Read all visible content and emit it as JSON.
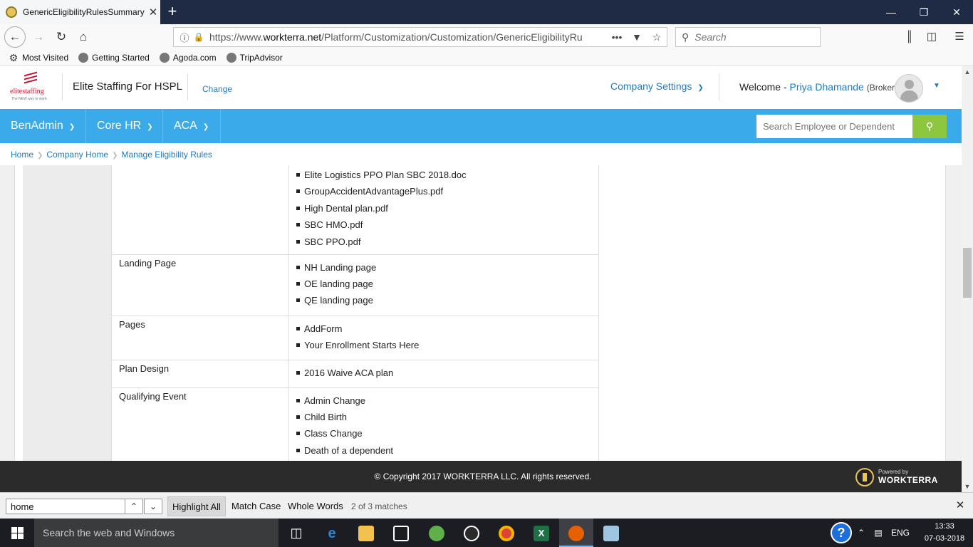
{
  "browser": {
    "tab_title": "GenericEligibilityRulesSummary",
    "tab_close": "✕",
    "new_tab": "+",
    "url_prefix": "https://www.",
    "url_domain": "workterra.net",
    "url_path": "/Platform/Customization/Customization/GenericEligibilityRu",
    "search_placeholder": "Search",
    "bookmarks": [
      {
        "label": "Most Visited",
        "icon": "gear-icon"
      },
      {
        "label": "Getting Started",
        "icon": "firefox-icon"
      },
      {
        "label": "Agoda.com",
        "icon": "globe-icon"
      },
      {
        "label": "TripAdvisor",
        "icon": "globe-icon"
      }
    ]
  },
  "header": {
    "logo_text": "elitestaffing",
    "logo_tagline": "The NEW way to work.",
    "company_name": "Elite Staffing For HSPL",
    "change_label": "Change",
    "company_settings_label": "Company Settings",
    "welcome_label": "Welcome -",
    "user_name": "Priya Dhamande",
    "user_role": "(Broker)"
  },
  "menu": {
    "items": [
      {
        "label": "BenAdmin"
      },
      {
        "label": "Core HR"
      },
      {
        "label": "ACA"
      }
    ],
    "search_placeholder": "Search Employee or Dependent"
  },
  "breadcrumb": [
    "Home",
    "Company Home",
    "Manage Eligibility Rules"
  ],
  "rules": {
    "first_row_values": [
      "Elite Logistics PPO Plan SBC 2018.doc",
      "GroupAccidentAdvantagePlus.pdf",
      "High Dental plan.pdf",
      "SBC HMO.pdf",
      "SBC PPO.pdf"
    ],
    "rows": [
      {
        "label": "Landing Page",
        "values": [
          "NH Landing page",
          "OE landing page",
          "QE landing page"
        ]
      },
      {
        "label": "Pages",
        "values": [
          "AddForm",
          "Your Enrollment Starts Here"
        ]
      },
      {
        "label": "Plan Design",
        "values": [
          "2016 Waive ACA plan"
        ]
      },
      {
        "label": "Qualifying Event",
        "values": [
          "Admin Change",
          "Child Birth",
          "Class Change",
          "Death of a dependent"
        ]
      }
    ]
  },
  "footer": {
    "copyright": "© Copyright 2017 WORKTERRA LLC. All rights reserved.",
    "powered_by": "Powered by",
    "brand": "WORKTERRA"
  },
  "findbar": {
    "query": "home",
    "highlight_all": "Highlight All",
    "match_case": "Match Case",
    "whole_words": "Whole Words",
    "status": "2 of 3 matches"
  },
  "taskbar": {
    "search_text": "Search the web and Windows",
    "language": "ENG",
    "time": "13:33",
    "date": "07-03-2018"
  }
}
